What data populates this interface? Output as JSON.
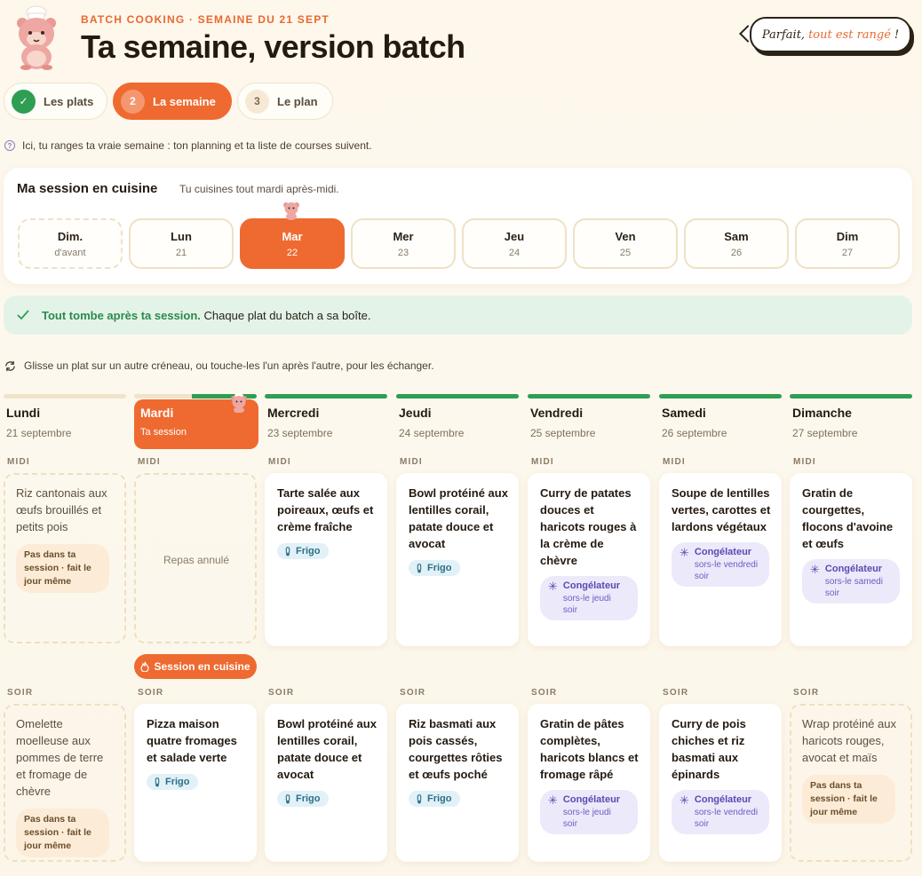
{
  "header": {
    "eyebrow": "BATCH COOKING · SEMAINE DU 21 SEPT",
    "title": "Ta semaine, version batch",
    "bubble_prefix": "Parfait,",
    "bubble_accent": "tout est rangé",
    "bubble_suffix": "!"
  },
  "steps": [
    {
      "num": "✓",
      "label": "Les plats"
    },
    {
      "num": "2",
      "label": "La semaine"
    },
    {
      "num": "3",
      "label": "Le plan"
    }
  ],
  "hint": "Ici, tu ranges ta vraie semaine : ton planning et ta liste de courses suivent.",
  "session": {
    "title": "Ma session en cuisine",
    "subtitle": "Tu cuisines tout mardi après-midi.",
    "days": [
      {
        "name": "Dim.",
        "date": "d'avant"
      },
      {
        "name": "Lun",
        "date": "21"
      },
      {
        "name": "Mar",
        "date": "22"
      },
      {
        "name": "Mer",
        "date": "23"
      },
      {
        "name": "Jeu",
        "date": "24"
      },
      {
        "name": "Ven",
        "date": "25"
      },
      {
        "name": "Sam",
        "date": "26"
      },
      {
        "name": "Dim",
        "date": "27"
      }
    ]
  },
  "success": {
    "strong": "Tout tombe après ta session.",
    "rest": "Chaque plat du batch a sa boîte."
  },
  "swap_hint": "Glisse un plat sur un autre créneau, ou touche-les l'un après l'autre, pour les échanger.",
  "slot_labels": {
    "midi": "MIDI",
    "soir": "SOIR"
  },
  "session_pill": "Session en cuisine",
  "badges": {
    "frigo": "Frigo",
    "congel": "Congélateur",
    "pas": "Pas dans ta session · fait le jour même",
    "cancelled": "Repas annulé"
  },
  "week": [
    {
      "day": "Lundi",
      "date": "21 septembre",
      "midi": {
        "name": "Riz cantonais aux œufs brouillés et petits pois",
        "type": "pas"
      },
      "soir": {
        "name": "Omelette moelleuse aux pommes de terre et fromage de chèvre",
        "type": "pas"
      }
    },
    {
      "day": "Mardi",
      "date": "Ta session",
      "midi": {
        "name": "",
        "type": "cancelled"
      },
      "soir": {
        "name": "Pizza maison quatre fromages et salade verte",
        "type": "frigo"
      }
    },
    {
      "day": "Mercredi",
      "date": "23 septembre",
      "midi": {
        "name": "Tarte salée aux poireaux, œufs et crème fraîche",
        "type": "frigo"
      },
      "soir": {
        "name": "Bowl protéiné aux lentilles corail, patate douce et avocat",
        "type": "frigo"
      }
    },
    {
      "day": "Jeudi",
      "date": "24 septembre",
      "midi": {
        "name": "Bowl protéiné aux lentilles corail, patate douce et avocat",
        "type": "frigo"
      },
      "soir": {
        "name": "Riz basmati aux pois cassés, courgettes rôties et œufs poché",
        "type": "frigo"
      }
    },
    {
      "day": "Vendredi",
      "date": "25 septembre",
      "midi": {
        "name": "Curry de patates douces et haricots rouges à la crème de chèvre",
        "type": "congel",
        "sub": "sors-le jeudi soir"
      },
      "soir": {
        "name": "Gratin de pâtes complètes, haricots blancs et fromage râpé",
        "type": "congel",
        "sub": "sors-le jeudi soir"
      }
    },
    {
      "day": "Samedi",
      "date": "26 septembre",
      "midi": {
        "name": "Soupe de lentilles vertes, carottes et lardons végétaux",
        "type": "congel",
        "sub": "sors-le vendredi soir"
      },
      "soir": {
        "name": "Curry de pois chiches et riz basmati aux épinards",
        "type": "congel",
        "sub": "sors-le vendredi soir"
      }
    },
    {
      "day": "Dimanche",
      "date": "27 septembre",
      "midi": {
        "name": "Gratin de courgettes, flocons d'avoine et œufs",
        "type": "congel",
        "sub": "sors-le samedi soir"
      },
      "soir": {
        "name": "Wrap protéiné aux haricots rouges, avocat et maïs",
        "type": "pas"
      }
    }
  ],
  "colors": {
    "accent": "#ef6a30",
    "success": "#2e9e52",
    "frigo_bg": "#e1f1f7",
    "congel_bg": "#ece9fb",
    "pas_bg": "#fcecd7"
  }
}
